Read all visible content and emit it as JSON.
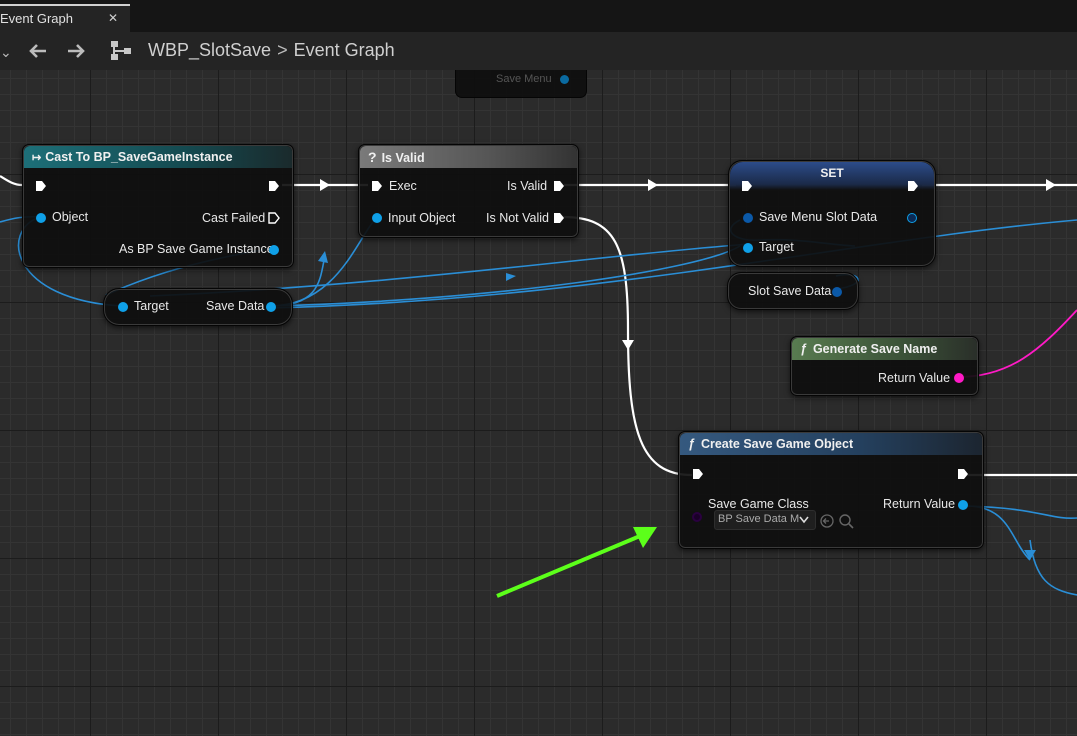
{
  "tab": {
    "title": "Event Graph",
    "close": "✕"
  },
  "toolbar": {
    "back": "🡐",
    "forward": "🡒",
    "breadcrumb": [
      "WBP_SlotSave",
      "Event Graph"
    ],
    "separator": ">"
  },
  "nodes": {
    "save_menu": {
      "label": "Save Menu"
    },
    "cast": {
      "title": "Cast To BP_SaveGameInstance",
      "pins": {
        "object": "Object",
        "cast_failed": "Cast Failed",
        "as_instance": "As BP Save Game Instance"
      },
      "color": "#1d6f78"
    },
    "get_save_data": {
      "pins": {
        "target": "Target",
        "save_data": "Save Data"
      }
    },
    "is_valid": {
      "title": "Is Valid",
      "icon": "?",
      "pins": {
        "exec": "Exec",
        "input_object": "Input Object",
        "is_valid": "Is Valid",
        "is_not_valid": "Is Not Valid"
      },
      "color": "#6f6f6f"
    },
    "set": {
      "title": "SET",
      "pins": {
        "save_menu_slot_data": "Save Menu Slot Data",
        "target": "Target"
      },
      "color": "#2a3f70"
    },
    "slot_save_data": {
      "label": "Slot Save Data"
    },
    "generate_save_name": {
      "title": "Generate Save Name",
      "icon": "ƒ",
      "pins": {
        "return_value": "Return Value"
      },
      "color": "#4b6b45"
    },
    "create_save_game": {
      "title": "Create Save Game Object",
      "icon": "ƒ",
      "pins": {
        "save_game_class": "Save Game Class",
        "class_value": "BP Save Data M",
        "return_value": "Return Value"
      },
      "color": "#2a4a70"
    }
  },
  "colors": {
    "object_pin": "#0fa0e8",
    "string_pin": "#ff1ac6",
    "exec_wire": "#ffffff",
    "annotation_arrow": "#5cff1a"
  },
  "icons": [
    "back-arrow-icon",
    "forward-arrow-icon",
    "blueprint-icon",
    "cast-icon",
    "question-icon",
    "function-icon",
    "dropdown-chevron-icon",
    "reset-arrow-icon",
    "magnifier-icon"
  ]
}
